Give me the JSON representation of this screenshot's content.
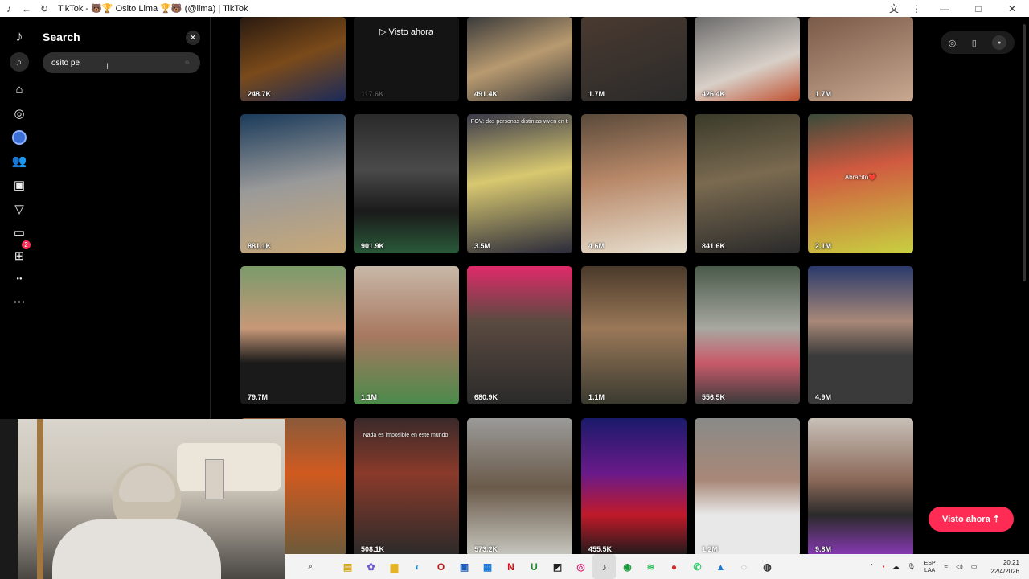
{
  "window": {
    "title": "TikTok - 🐻🏆 Osito Lima 🏆🐻 (@lima) | TikTok",
    "controls": {
      "minimize": "—",
      "maximize": "□",
      "close": "✕"
    }
  },
  "sidebar": {
    "notification_count": "2"
  },
  "search": {
    "title": "Search",
    "value": "osito pe",
    "close_glyph": "✕"
  },
  "grid": {
    "tiles": [
      {
        "views": "248.7K",
        "caption": ""
      },
      {
        "views": "117.6K",
        "caption": "",
        "now_label": "▷ Visto ahora"
      },
      {
        "views": "491.4K",
        "caption": ""
      },
      {
        "views": "1.7M",
        "caption": ""
      },
      {
        "views": "426.4K",
        "caption": ""
      },
      {
        "views": "1.7M",
        "caption": ""
      },
      {
        "views": "881.1K",
        "caption": ""
      },
      {
        "views": "901.9K",
        "caption": ""
      },
      {
        "views": "3.5M",
        "caption": "POV: dos personas distintas viven en ti"
      },
      {
        "views": "4.6M",
        "caption": ""
      },
      {
        "views": "841.6K",
        "caption": ""
      },
      {
        "views": "2.1M",
        "caption": "Abracito❤️"
      },
      {
        "views": "79.7M",
        "caption": ""
      },
      {
        "views": "1.1M",
        "caption": ""
      },
      {
        "views": "680.9K",
        "caption": ""
      },
      {
        "views": "1.1M",
        "caption": ""
      },
      {
        "views": "556.5K",
        "caption": ""
      },
      {
        "views": "4.9M",
        "caption": ""
      },
      {
        "views": "",
        "caption": ""
      },
      {
        "views": "508.1K",
        "caption": "Nada es imposible en este mundo."
      },
      {
        "views": "573.2K",
        "caption": ""
      },
      {
        "views": "455.5K",
        "caption": ""
      },
      {
        "views": "1.2M",
        "caption": ""
      },
      {
        "views": "9.8M",
        "caption": ""
      }
    ]
  },
  "floating": {
    "visto_ahora": "Visto ahora ⇡"
  },
  "taskbar": {
    "lang_top": "ESP",
    "lang_bottom": "LAA",
    "time": "20:21",
    "date": "22/4/2026"
  }
}
